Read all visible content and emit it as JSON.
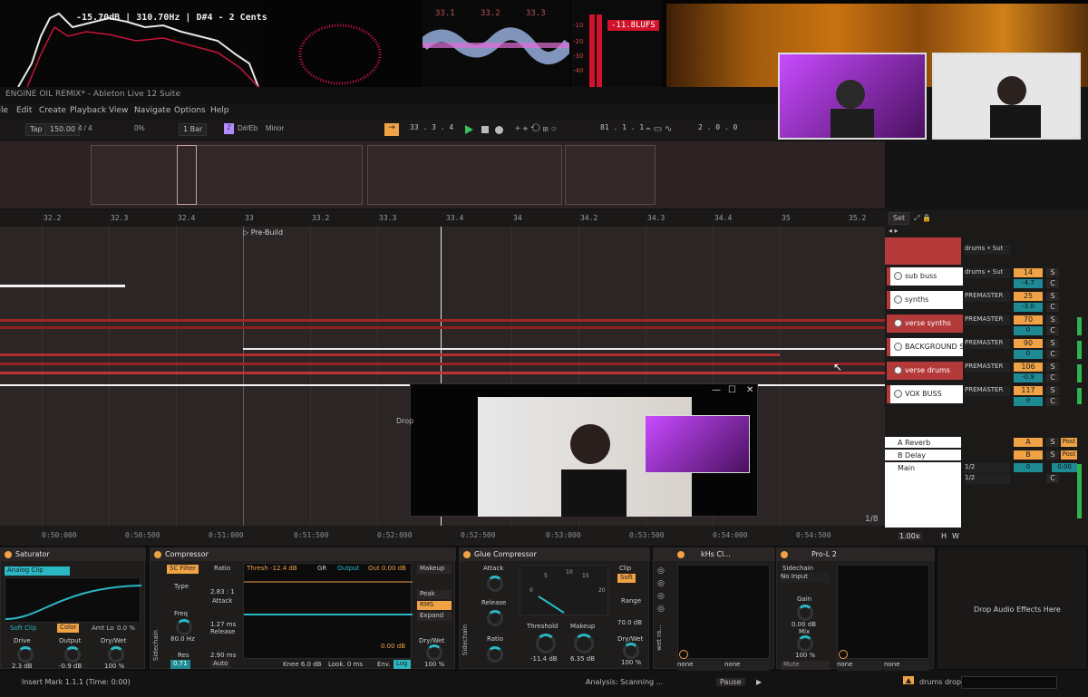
{
  "analyzers": {
    "spectrum_readout": "-15.70dB | 310.70Hz | D#4 - 2 Cents",
    "wave_labels": [
      "33.1",
      "33.2",
      "33.3"
    ],
    "meter_scale": [
      "-10",
      "-20",
      "-30",
      "-40"
    ],
    "lufs": "-11.8LUFS"
  },
  "window": {
    "title": "ENGINE OIL REMIX* - Ableton Live 12 Suite"
  },
  "menu": [
    "File",
    "Edit",
    "Create",
    "Playback",
    "View",
    "Navigate",
    "Options",
    "Help"
  ],
  "control_bar": {
    "tap": "Tap",
    "tempo": "150.00",
    "meter": "4 / 4",
    "cpu": "0%",
    "quantize": "1 Bar",
    "key": "D#/Eb",
    "scale": "Minor",
    "position": "33 . 3 . 4",
    "loop_start": "81 . 1 . 1",
    "loop_len": "2 . 0 . 0"
  },
  "ruler": [
    "32.2",
    "32.3",
    "32.4",
    "33",
    "33.2",
    "33.3",
    "33.4",
    "34",
    "34.2",
    "34.3",
    "34.4",
    "35",
    "35.2"
  ],
  "locator": "Pre-Build",
  "timeline": [
    "0:50:000",
    "0:50:500",
    "0:51:000",
    "0:51:500",
    "0:52:000",
    "0:52:500",
    "0:53:000",
    "0:53:500",
    "0:54:000",
    "0:54:500"
  ],
  "page_indicator": "1/8",
  "set_button": "Set",
  "mixer": {
    "tracks": [
      {
        "name": "sub buss",
        "route": "drums • Sut",
        "vol": "14",
        "pan": "-4.7",
        "solo": "S",
        "c": "C"
      },
      {
        "name": "synths",
        "route": "PREMASTER",
        "vol": "25",
        "pan": "-3.0",
        "solo": "S",
        "c": "C"
      },
      {
        "name": "verse synths",
        "route": "PREMASTER",
        "vol": "70",
        "pan": "0",
        "solo": "S",
        "c": "C"
      },
      {
        "name": "BACKGROUND SHI",
        "route": "PREMASTER",
        "vol": "90",
        "pan": "0",
        "solo": "S",
        "c": "C"
      },
      {
        "name": "verse drums",
        "route": "PREMASTER",
        "vol": "106",
        "pan": "-0.9",
        "solo": "S",
        "c": "C"
      },
      {
        "name": "VOX BUSS",
        "route": "PREMASTER",
        "vol": "117",
        "pan": "0",
        "solo": "S",
        "c": "C"
      }
    ],
    "top_route": "drums • Sut",
    "returns": [
      {
        "name": "A Reverb",
        "vol": "A",
        "solo": "S",
        "post": "Post"
      },
      {
        "name": "B Delay",
        "vol": "B",
        "solo": "S",
        "post": "Post"
      }
    ],
    "main": {
      "name": "Main",
      "route1": "1/2",
      "route2": "1/2",
      "vol": "0",
      "pan": "0.00",
      "c": "C"
    },
    "zoom": "1.00x",
    "hw": [
      "H",
      "W"
    ]
  },
  "devices": {
    "saturator": {
      "title": "Saturator",
      "mode": "Analog Clip",
      "soft_clip": "Soft Clip",
      "color": "Color",
      "amt": "Amt Lo",
      "amt_val": "0.0 %",
      "knobs": [
        {
          "label": "Drive",
          "value": "2.3 dB"
        },
        {
          "label": "Output",
          "value": "-0.9 dB"
        },
        {
          "label": "Dry/Wet",
          "value": "100 %"
        }
      ]
    },
    "compressor": {
      "title": "Compressor",
      "sc_filter": "SC Filter",
      "type": "Type",
      "freq": "Freq",
      "freq_val": "80.0 Hz",
      "res": "Res",
      "res_val": "0.71",
      "ratio": "Ratio",
      "ratio_val": "2.83 : 1",
      "attack": "Attack",
      "attack_val": "1.27 ms",
      "release": "Release",
      "release_val": "2.90 ms",
      "auto": "Auto",
      "thresh": "Thresh -12.4 dB",
      "gr": "GR",
      "output": "Output",
      "out": "Out 0.00 dB",
      "out_db": "0.00 dB",
      "makeup": "Makeup",
      "peak": "Peak",
      "rms": "RMS",
      "expand": "Expand",
      "drywet": "Dry/Wet",
      "drywet_val": "100 %",
      "knee": "Knee 6.0 dB",
      "look": "Look. 0 ms",
      "env": "Env.",
      "log": "Log",
      "sidechain": "Sidechain"
    },
    "glue": {
      "title": "Glue Compressor",
      "attack": "Attack",
      "release": "Release",
      "ratio": "Ratio",
      "threshold": "Threshold",
      "threshold_val": "-11.4 dB",
      "makeup": "Makeup",
      "makeup_val": "6.35 dB",
      "clip": "Clip",
      "soft": "Soft",
      "range": "Range",
      "range_val": "70.0 dB",
      "drywet": "Dry/Wet",
      "drywet_val": "100 %",
      "scale": [
        "0",
        "5",
        "10",
        "15",
        "20"
      ],
      "sidechain": "Sidechain"
    },
    "kilo": {
      "title": "kHs Cl...",
      "opt1": "none",
      "opt2": "none",
      "side": "wet ra..."
    },
    "prol2": {
      "title": "Pro-L 2",
      "sidechain": "Sidechain",
      "no_input": "No Input",
      "gain": "Gain",
      "gain_val": "0.00 dB",
      "mix": "Mix",
      "mix_val": "100 %",
      "mute": "Mute",
      "opt1": "none",
      "opt2": "none"
    },
    "drop_hint": "Drop Audio Effects Here"
  },
  "status": {
    "left": "Insert Mark 1.1.1 (Time: 0:00)",
    "analysis": "Analysis: Scanning ...",
    "pause": "Pause",
    "clip_name": "drums drop"
  },
  "popup_text": "Drop"
}
